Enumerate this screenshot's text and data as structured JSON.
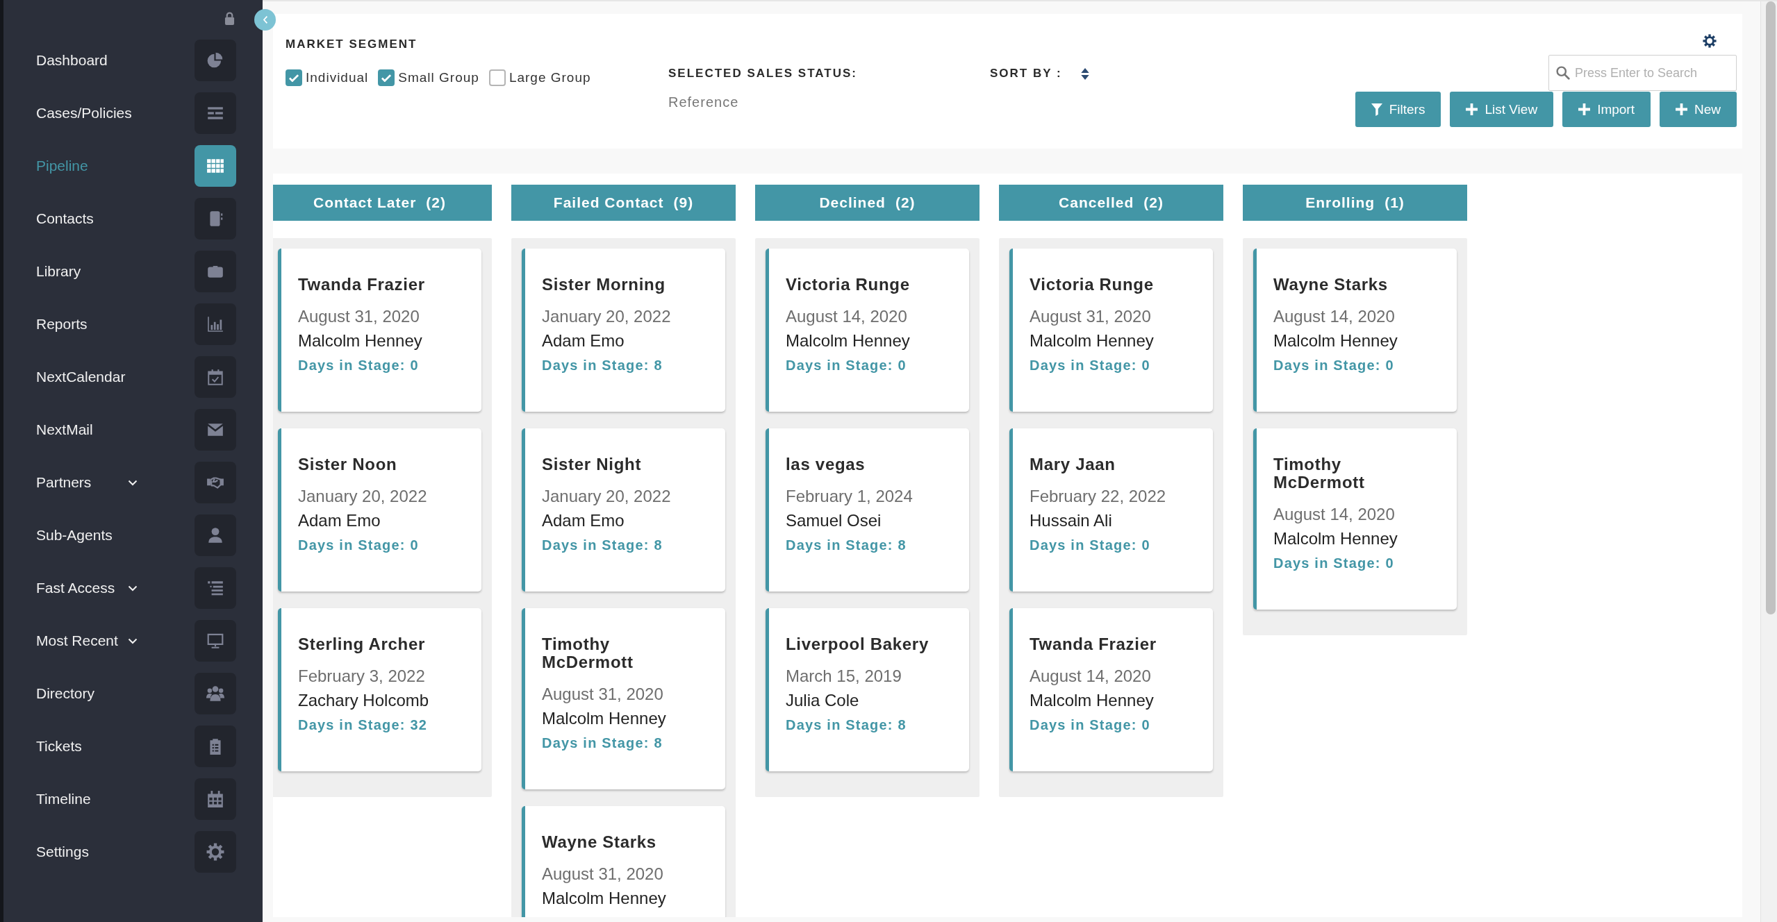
{
  "sidebar": {
    "items": [
      {
        "label": "Dashboard",
        "kind": "link",
        "selected": false
      },
      {
        "label": "Cases/Policies",
        "kind": "link",
        "selected": false
      },
      {
        "label": "Pipeline",
        "kind": "link",
        "selected": true
      },
      {
        "label": "Contacts",
        "kind": "link",
        "selected": false
      },
      {
        "label": "Library",
        "kind": "link",
        "selected": false
      },
      {
        "label": "Reports",
        "kind": "link",
        "selected": false
      },
      {
        "label": "NextCalendar",
        "kind": "link",
        "selected": false
      },
      {
        "label": "NextMail",
        "kind": "link",
        "selected": false
      },
      {
        "label": "Partners",
        "kind": "group",
        "selected": false
      },
      {
        "label": "Sub-Agents",
        "kind": "link",
        "selected": false
      },
      {
        "label": "Fast Access",
        "kind": "group",
        "selected": false
      },
      {
        "label": "Most Recent",
        "kind": "group",
        "selected": false
      },
      {
        "label": "Directory",
        "kind": "link",
        "selected": false
      },
      {
        "label": "Tickets",
        "kind": "link",
        "selected": false
      },
      {
        "label": "Timeline",
        "kind": "link",
        "selected": false
      },
      {
        "label": "Settings",
        "kind": "link",
        "selected": false
      }
    ]
  },
  "filters": {
    "market_segment": {
      "title": "MARKET SEGMENT",
      "options": [
        {
          "label": "Individual",
          "checked": true
        },
        {
          "label": "Small Group",
          "checked": true
        },
        {
          "label": "Large Group",
          "checked": false
        }
      ]
    },
    "sales_status": {
      "title": "SELECTED SALES STATUS:",
      "value": "Reference"
    },
    "sort": {
      "title": "SORT BY :"
    },
    "search": {
      "placeholder": "Press Enter to Search"
    },
    "buttons": [
      {
        "label": "Filters",
        "kind": "filter"
      },
      {
        "label": "List View",
        "kind": "add"
      },
      {
        "label": "Import",
        "kind": "add"
      },
      {
        "label": "New",
        "kind": "add"
      }
    ]
  },
  "board": {
    "columns": [
      {
        "title": "Contact Later",
        "count": "(2)",
        "cards": [
          {
            "name": "Twanda Frazier",
            "date": "August 31, 2020",
            "agent": "Malcolm Henney",
            "days": "Days in Stage: 0"
          },
          {
            "name": "Sister Noon",
            "date": "January 20, 2022",
            "agent": "Adam Emo",
            "days": "Days in Stage: 0"
          },
          {
            "name": "Sterling Archer",
            "date": "February 3, 2022",
            "agent": "Zachary Holcomb",
            "days": "Days in Stage: 32"
          }
        ]
      },
      {
        "title": "Failed Contact",
        "count": "(9)",
        "cards": [
          {
            "name": "Sister Morning",
            "date": "January 20, 2022",
            "agent": "Adam Emo",
            "days": "Days in Stage: 8"
          },
          {
            "name": "Sister Night",
            "date": "January 20, 2022",
            "agent": "Adam Emo",
            "days": "Days in Stage: 8"
          },
          {
            "name": "Timothy McDermott",
            "date": "August 31, 2020",
            "agent": "Malcolm Henney",
            "days": "Days in Stage: 8"
          },
          {
            "name": "Wayne Starks",
            "date": "August 31, 2020",
            "agent": "Malcolm Henney"
          }
        ]
      },
      {
        "title": "Declined",
        "count": "(2)",
        "cards": [
          {
            "name": "Victoria Runge",
            "date": "August 14, 2020",
            "agent": "Malcolm Henney",
            "days": "Days in Stage: 0"
          },
          {
            "name": "las vegas",
            "date": "February 1, 2024",
            "agent": "Samuel Osei",
            "days": "Days in Stage: 8"
          },
          {
            "name": "Liverpool Bakery",
            "date": "March 15, 2019",
            "agent": "Julia Cole",
            "days": "Days in Stage: 8"
          }
        ]
      },
      {
        "title": "Cancelled",
        "count": "(2)",
        "cards": [
          {
            "name": "Victoria Runge",
            "date": "August 31, 2020",
            "agent": "Malcolm Henney",
            "days": "Days in Stage: 0"
          },
          {
            "name": "Mary Jaan",
            "date": "February 22, 2022",
            "agent": "Hussain Ali",
            "days": "Days in Stage: 0"
          },
          {
            "name": "Twanda Frazier",
            "date": "August 14, 2020",
            "agent": "Malcolm Henney",
            "days": "Days in Stage: 0"
          }
        ]
      },
      {
        "title": "Enrolling",
        "count": "(1)",
        "cards": [
          {
            "name": "Wayne Starks",
            "date": "August 14, 2020",
            "agent": "Malcolm Henney",
            "days": "Days in Stage: 0"
          },
          {
            "name": "Timothy McDermott",
            "date": "August 14, 2020",
            "agent": "Malcolm Henney",
            "days": "Days in Stage: 0"
          }
        ]
      }
    ]
  }
}
